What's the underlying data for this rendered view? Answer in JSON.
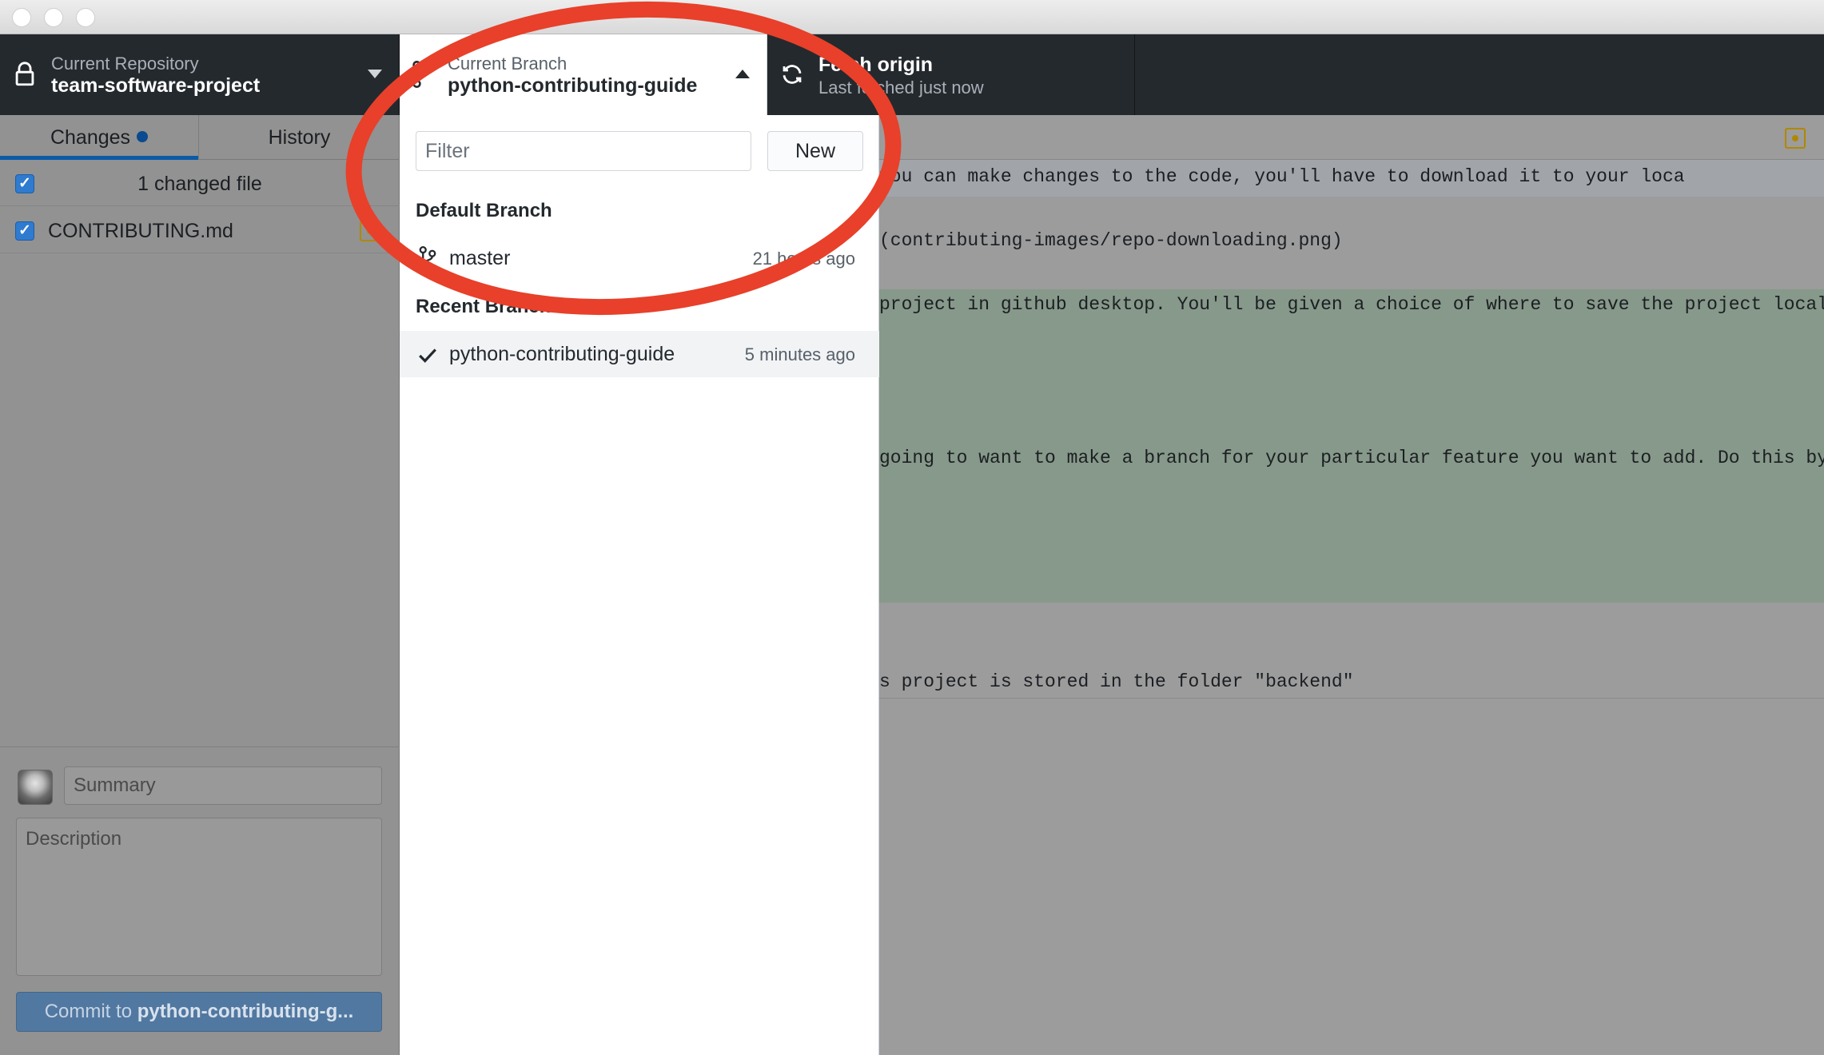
{
  "toolbar": {
    "repository": {
      "label": "Current Repository",
      "name": "team-software-project"
    },
    "branch": {
      "label": "Current Branch",
      "name": "python-contributing-guide"
    },
    "fetch": {
      "title": "Fetch origin",
      "subtitle": "Last fetched just now"
    }
  },
  "sidebar": {
    "tabs": {
      "changes": "Changes",
      "history": "History"
    },
    "changed_files_label": "1 changed file",
    "files": [
      {
        "name": "CONTRIBUTING.md"
      }
    ],
    "commit": {
      "summary_placeholder": "Summary",
      "description_placeholder": "Description",
      "button_prefix": "Commit to ",
      "button_branch": "python-contributing-g..."
    }
  },
  "branch_panel": {
    "filter_placeholder": "Filter",
    "new_button": "New",
    "default_heading": "Default Branch",
    "default_branch": {
      "name": "master",
      "time": "21 hours ago"
    },
    "recent_heading": "Recent Branches",
    "recent_branches": [
      {
        "name": "python-contributing-guide",
        "time": "5 minutes ago"
      }
    ]
  },
  "diff": {
    "lines": [
      "you can make changes to the code, you'll have to download it to your loca",
      "(contributing-images/repo-downloading.png)",
      "project in github desktop. You'll be given a choice of where to save the project locally,",
      "going to want to make a branch for your particular feature you want to add. Do this by",
      "s project is stored in the folder \"backend\""
    ]
  },
  "colors": {
    "annotation": "#e8402a",
    "accent": "#0c5aa6",
    "added_band": "#87998a"
  }
}
